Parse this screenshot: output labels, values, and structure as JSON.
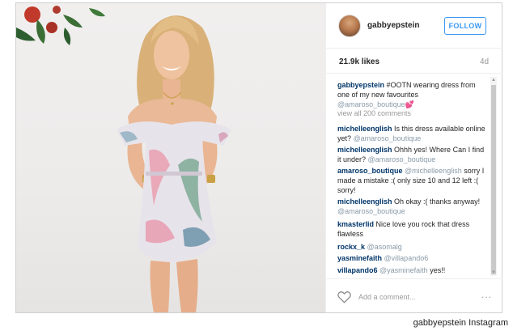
{
  "post": {
    "username": "gabbyepstein",
    "follow_label": "FOLLOW",
    "likes": "21.9k likes",
    "age": "4d",
    "caption": {
      "user": "gabbyepstein",
      "text": " #OOTN wearing dress from one of my new favourites ",
      "mention": "@amaroso_boutique",
      "emoji": "💕"
    },
    "view_all": "view all 200 comments",
    "comments": [
      {
        "user": "michelleenglish",
        "text": " Is this dress available online yet? ",
        "mention": "@amaroso_boutique"
      },
      {
        "user": "michelleenglish",
        "text": " Ohhh yes! Where Can I find it under? ",
        "mention": "@amaroso_boutique"
      },
      {
        "user": "amaroso_boutique",
        "text": " sorry I made a mistake :( only size 10 and 12 left :( sorry!",
        "mention": "@michelleenglish",
        "mention_first": true
      },
      {
        "user": "michelleenglish",
        "text": " Oh okay :( thanks anyway! ",
        "mention": "@amaroso_boutique"
      },
      {
        "user": "kmasterlid",
        "text": " Nice love you rock that dress flawless",
        "mention": ""
      },
      {
        "user": "rockx_k",
        "text": " ",
        "mention": "@asomalg"
      },
      {
        "user": "yasminefaith",
        "text": " ",
        "mention": "@villapando6"
      },
      {
        "user": "villapando6",
        "text": " yes!!",
        "mention": "@yasminefaith",
        "mention_first": true
      }
    ],
    "comment_placeholder": "Add a comment...",
    "more_label": "...",
    "icons": {
      "heart": "heart-icon",
      "avatar": "avatar",
      "more": "more-options-icon"
    }
  },
  "credit": "gabbyepstein Instagram",
  "colors": {
    "follow": "#3897f0",
    "username": "#003569",
    "muted": "#999999",
    "border": "#efefef"
  }
}
